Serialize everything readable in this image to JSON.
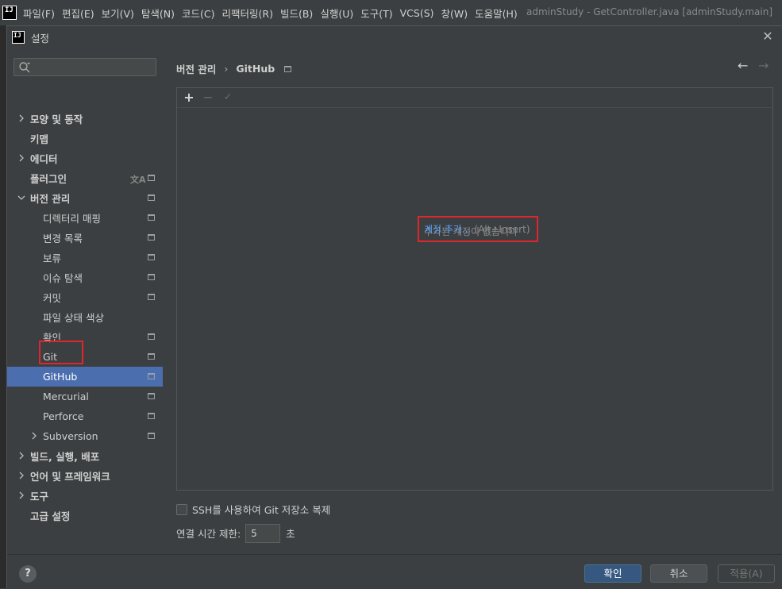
{
  "menubar": {
    "items": [
      "파일(F)",
      "편집(E)",
      "보기(V)",
      "탐색(N)",
      "코드(C)",
      "리팩터링(R)",
      "빌드(B)",
      "실행(U)",
      "도구(T)",
      "VCS(S)",
      "창(W)",
      "도움말(H)"
    ],
    "window_title": "adminStudy - GetController.java [adminStudy.main]",
    "logo_text": "IJ"
  },
  "dialog": {
    "title": "설정",
    "close_glyph": "✕"
  },
  "sidebar": {
    "search_placeholder": "",
    "items": [
      {
        "label": "모양 및 동작",
        "bold": true
      },
      {
        "label": "키맵",
        "bold": true
      },
      {
        "label": "에디터",
        "bold": true
      },
      {
        "label": "플러그인",
        "bold": true
      },
      {
        "label": "버전 관리",
        "bold": true
      },
      {
        "label": "디렉터리 매핑"
      },
      {
        "label": "변경 목록"
      },
      {
        "label": "보류"
      },
      {
        "label": "이슈 탐색"
      },
      {
        "label": "커밋"
      },
      {
        "label": "파일 상태 색상"
      },
      {
        "label": "확인"
      },
      {
        "label": "Git"
      },
      {
        "label": "GitHub",
        "selected": true
      },
      {
        "label": "Mercurial"
      },
      {
        "label": "Perforce"
      },
      {
        "label": "Subversion"
      },
      {
        "label": "빌드, 실행, 배포",
        "bold": true
      },
      {
        "label": "언어 및 프레임워크",
        "bold": true
      },
      {
        "label": "도구",
        "bold": true
      },
      {
        "label": "고급 설정",
        "bold": true
      }
    ],
    "lang_icon_glyph": "文A"
  },
  "content": {
    "breadcrumb_parent": "버전 관리",
    "breadcrumb_sep": "›",
    "breadcrumb_current": "GitHub",
    "nav_back": "←",
    "nav_forward": "→",
    "toolbar": {
      "add": "+",
      "remove": "−",
      "check": "✓"
    },
    "empty_text": "추가된 계정이 없습니다",
    "add_account_link": "계정 추가...",
    "add_account_hint": "(Alt+Insert)",
    "ssh_label": "SSH를 사용하여 Git 저장소 복제",
    "timeout_label": "연결 시간 제한:",
    "timeout_value": "5",
    "timeout_unit": "초"
  },
  "footer": {
    "help": "?",
    "ok": "확인",
    "cancel": "취소",
    "apply": "적용(A)"
  },
  "colors": {
    "selection": "#4b6eaf",
    "link": "#589df6",
    "highlight": "#e0262d",
    "ok_button": "#365880"
  }
}
